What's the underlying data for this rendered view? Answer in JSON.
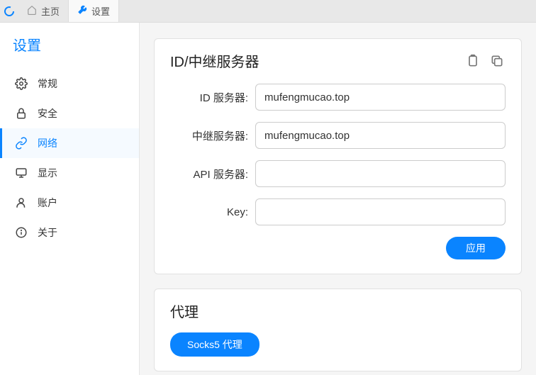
{
  "tabs": {
    "home": "主页",
    "settings": "设置"
  },
  "sidebar": {
    "title": "设置",
    "items": [
      {
        "label": "常规"
      },
      {
        "label": "安全"
      },
      {
        "label": "网络"
      },
      {
        "label": "显示"
      },
      {
        "label": "账户"
      },
      {
        "label": "关于"
      }
    ]
  },
  "server_card": {
    "title": "ID/中继服务器",
    "fields": {
      "id_server": {
        "label": "ID 服务器:",
        "value": "mufengmucao.top"
      },
      "relay_server": {
        "label": "中继服务器:",
        "value": "mufengmucao.top"
      },
      "api_server": {
        "label": "API 服务器:",
        "value": ""
      },
      "key": {
        "label": "Key:",
        "value": ""
      }
    },
    "apply_label": "应用"
  },
  "proxy_card": {
    "title": "代理",
    "socks5_label": "Socks5 代理"
  },
  "colors": {
    "accent": "#0a84ff"
  }
}
